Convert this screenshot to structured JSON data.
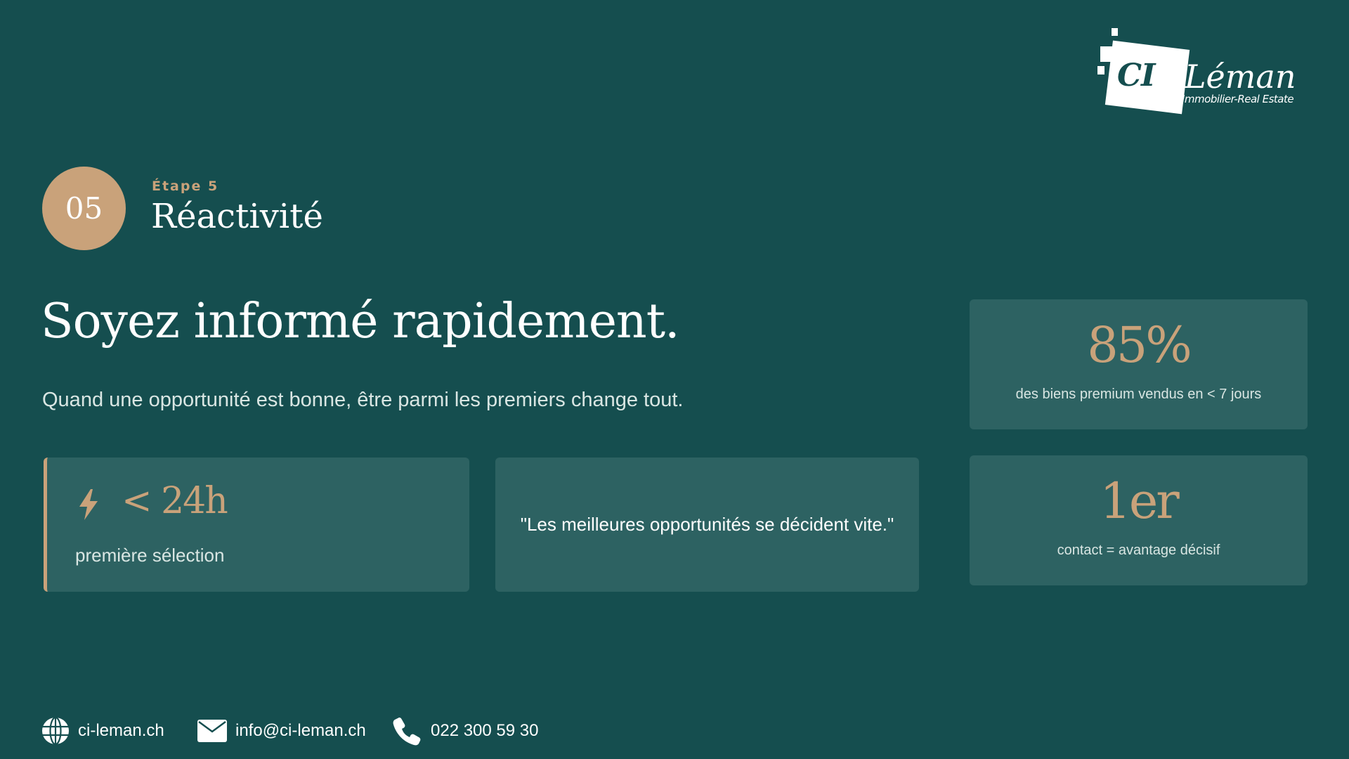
{
  "brand": {
    "logo_mark": "CI",
    "name": "Léman",
    "tagline": "Immobilier-Real Estate"
  },
  "step": {
    "number": "05",
    "label": "Étape 5",
    "title": "Réactivité"
  },
  "headline": "Soyez informé rapidement.",
  "subline": "Quand une opportunité est bonne, être parmi les premiers change tout.",
  "highlight_card": {
    "icon": "lightning-bolt-icon",
    "value": "< 24h",
    "caption": "première sélection"
  },
  "quote_card": {
    "text": "\"Les meilleures opportunités se décident vite.\""
  },
  "stats": [
    {
      "value": "85%",
      "caption": "des biens premium vendus en < 7 jours"
    },
    {
      "value": "1er",
      "caption": "contact = avantage décisif"
    }
  ],
  "footer": {
    "website": {
      "icon": "globe-icon",
      "text": "ci-leman.ch"
    },
    "email": {
      "icon": "envelope-icon",
      "text": "info@ci-leman.ch"
    },
    "phone": {
      "icon": "phone-icon",
      "text": "022 300 59 30"
    }
  },
  "colors": {
    "background": "#154e4f",
    "card": "#2d6262",
    "accent": "#c9a27a"
  }
}
